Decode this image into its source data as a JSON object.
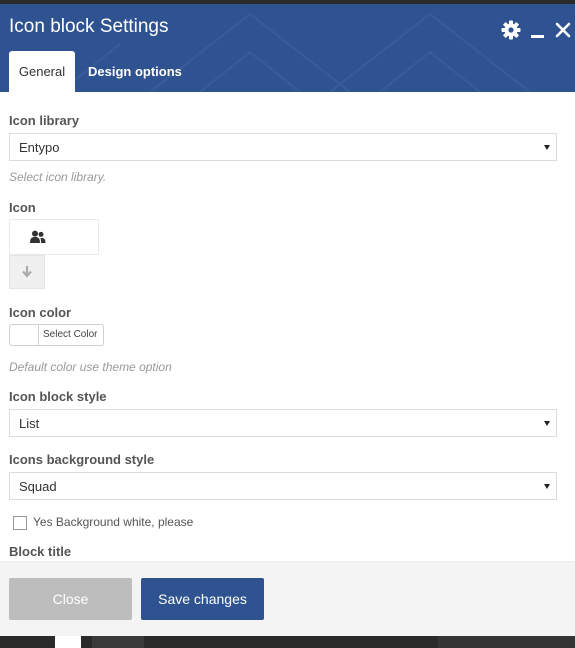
{
  "dialog": {
    "title": "Icon block Settings",
    "header_color": "#2f5390",
    "header_icons": [
      "gear-icon",
      "minimize-icon",
      "close-icon"
    ]
  },
  "tabs": [
    {
      "label": "General",
      "active": true
    },
    {
      "label": "Design options",
      "active": false
    }
  ],
  "fields": {
    "icon_library": {
      "label": "Icon library",
      "value": "Entypo",
      "help": "Select icon library."
    },
    "icon": {
      "label": "Icon",
      "preview_icon": "users-icon",
      "toggle_icon": "arrow-down-icon"
    },
    "icon_color": {
      "label": "Icon color",
      "button_label": "Select Color",
      "help": "Default color use theme option"
    },
    "icon_block_style": {
      "label": "Icon block style",
      "value": "List"
    },
    "icons_background_style": {
      "label": "Icons background style",
      "value": "Squad"
    },
    "bg_white": {
      "label": "Yes Background white, please",
      "checked": false
    },
    "block_title": {
      "label": "Block title"
    }
  },
  "footer": {
    "close_label": "Close",
    "save_label": "Save changes"
  }
}
